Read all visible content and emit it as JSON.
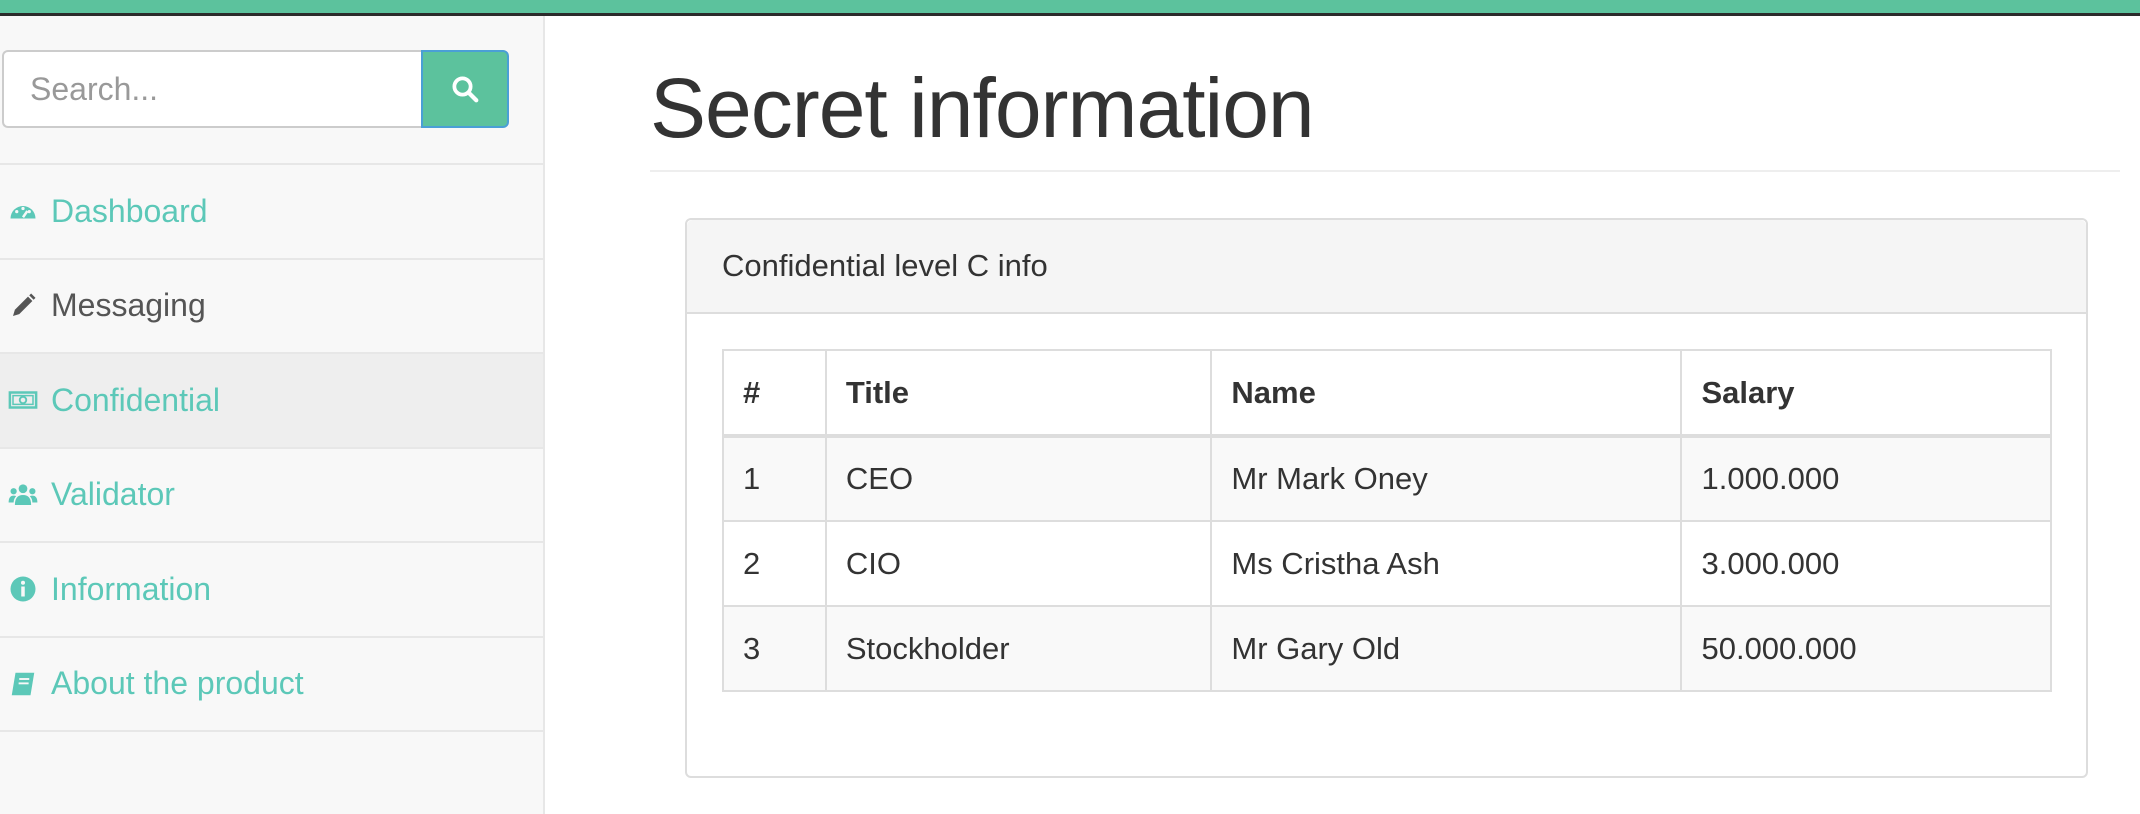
{
  "search": {
    "placeholder": "Search..."
  },
  "sidebar": {
    "items": [
      {
        "label": "Dashboard",
        "icon": "dashboard-icon"
      },
      {
        "label": "Messaging",
        "icon": "pencil-icon"
      },
      {
        "label": "Confidential",
        "icon": "money-icon"
      },
      {
        "label": "Validator",
        "icon": "users-icon"
      },
      {
        "label": "Information",
        "icon": "info-circle-icon"
      },
      {
        "label": "About the product",
        "icon": "book-icon"
      }
    ],
    "active_item": "Confidential"
  },
  "main": {
    "title": "Secret information",
    "panel": {
      "heading": "Confidential level C info",
      "table": {
        "headers": [
          "#",
          "Title",
          "Name",
          "Salary"
        ],
        "rows": [
          [
            "1",
            "CEO",
            "Mr Mark Oney",
            "1.000.000"
          ],
          [
            "2",
            "CIO",
            "Ms Cristha Ash",
            "3.000.000"
          ],
          [
            "3",
            "Stockholder",
            "Mr Gary Old",
            "50.000.000"
          ]
        ]
      }
    }
  },
  "colors": {
    "accent": "#5cc29d",
    "link": "#5cc8b8",
    "muted_text": "#555555",
    "text": "#333333",
    "border": "#dddddd"
  }
}
